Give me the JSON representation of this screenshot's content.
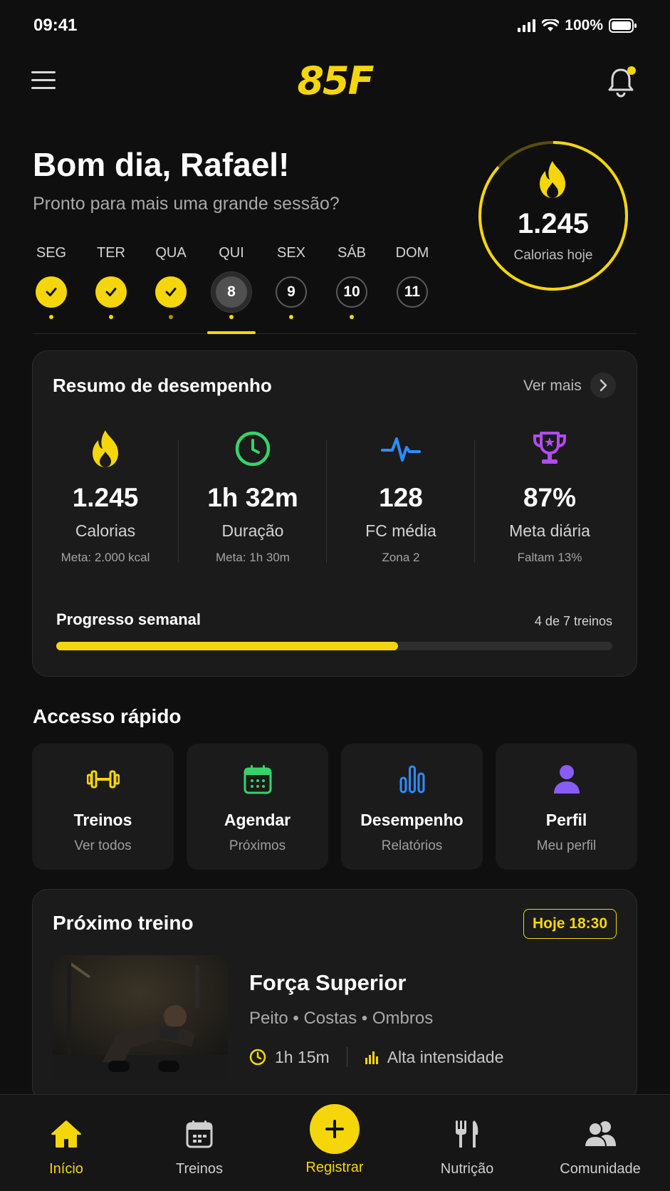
{
  "status_bar": {
    "time": "09:41",
    "battery": "100%"
  },
  "header": {
    "logo": "85F",
    "menu_icon": "menu-icon",
    "bell_icon": "bell-icon"
  },
  "greeting": {
    "title": "Bom dia, Rafael!",
    "subtitle": "Pronto para mais uma grande sessão?"
  },
  "week": {
    "days": [
      {
        "name": "SEG",
        "num": "",
        "state": "done"
      },
      {
        "name": "TER",
        "num": "",
        "state": "done"
      },
      {
        "name": "QUA",
        "num": "",
        "state": "done"
      },
      {
        "name": "QUI",
        "num": "8",
        "state": "today"
      },
      {
        "name": "SEX",
        "num": "9",
        "state": "open"
      },
      {
        "name": "SÁB",
        "num": "10",
        "state": "open"
      },
      {
        "name": "DOM",
        "num": "11",
        "state": "open"
      }
    ]
  },
  "calorie_ring": {
    "value": "1.245",
    "label": "Calorias hoje",
    "icon": "flame-icon"
  },
  "performance": {
    "title": "Resumo de desempenho",
    "more_label": "Ver mais",
    "stats": [
      {
        "value": "1.245",
        "label": "Calorias",
        "sub": "Meta: 2.000 kcal",
        "icon": "flame-icon",
        "color": "#F5D60A"
      },
      {
        "value": "1h 32m",
        "label": "Duração",
        "sub": "Meta: 1h 30m",
        "icon": "clock-icon",
        "color": "#35D46A"
      },
      {
        "value": "128",
        "label": "FC média",
        "sub": "Zona 2",
        "icon": "heartbeat-icon",
        "color": "#2F8CFF"
      },
      {
        "value": "87%",
        "label": "Meta diária",
        "sub": "Faltam 13%",
        "icon": "trophy-icon",
        "color": "#B04CF0"
      }
    ],
    "progress": {
      "title": "Progresso semanal",
      "count": "4 de 7 treinos",
      "fraction": 0.615
    }
  },
  "quick_access": {
    "title": "Accesso rápido",
    "items": [
      {
        "title": "Treinos",
        "sub": "Ver todos",
        "icon": "dumbbell-icon",
        "color": "#F5D60A"
      },
      {
        "title": "Agendar",
        "sub": "Próximos",
        "icon": "calendar-icon",
        "color": "#35D46A"
      },
      {
        "title": "Desempenho",
        "sub": "Relatórios",
        "icon": "bar-chart-icon",
        "color": "#2F8CFF"
      },
      {
        "title": "Perfil",
        "sub": "Meu perfil",
        "icon": "user-icon",
        "color": "#8A5CF6"
      }
    ]
  },
  "next_workout": {
    "title": "Próximo treino",
    "time_badge": "Hoje 18:30",
    "name": "Força Superior",
    "groups": "Peito • Costas • Ombros",
    "duration": "1h 15m",
    "intensity": "Alta intensidade"
  },
  "bottom_nav": {
    "items": [
      {
        "label": "Início",
        "icon": "home-icon"
      },
      {
        "label": "Treinos",
        "icon": "calendar-icon"
      },
      {
        "label": "Registrar",
        "icon": "plus-icon"
      },
      {
        "label": "Nutrição",
        "icon": "fork-knife-icon"
      },
      {
        "label": "Comunidade",
        "icon": "users-icon"
      }
    ]
  }
}
